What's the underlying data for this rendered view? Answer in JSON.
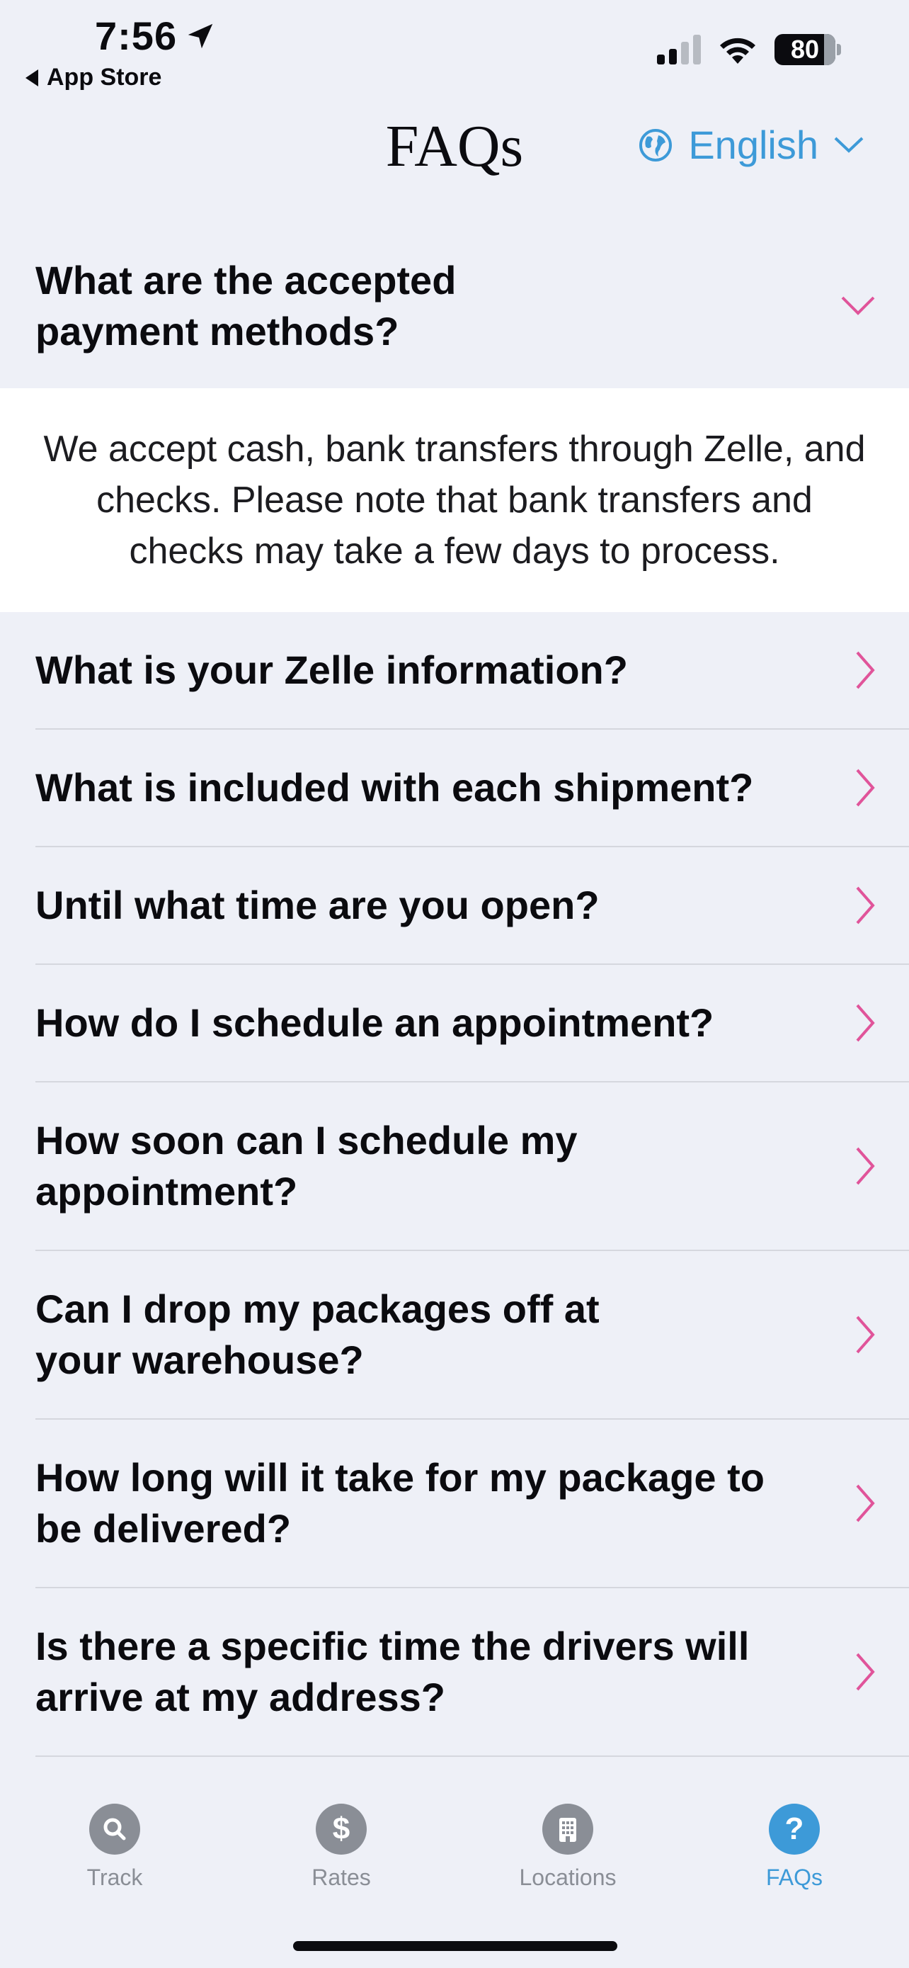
{
  "status_bar": {
    "time": "7:56",
    "back_label": "App Store",
    "battery": "80"
  },
  "header": {
    "title": "FAQs",
    "language": "English"
  },
  "faqs": [
    {
      "question": "What are the accepted payment methods?",
      "expanded": true,
      "answer": "We accept cash, bank transfers through Zelle, and checks. Please note that bank transfers and checks may take a few days to process."
    },
    {
      "question": "What is your Zelle information?",
      "expanded": false
    },
    {
      "question": "What is included with each shipment?",
      "expanded": false
    },
    {
      "question": "Until what time are you open?",
      "expanded": false
    },
    {
      "question": "How do I schedule an appointment?",
      "expanded": false
    },
    {
      "question": "How soon can I schedule my appointment?",
      "expanded": false
    },
    {
      "question": "Can I drop my packages off at your warehouse?",
      "expanded": false
    },
    {
      "question": "How long will it take for my package to be delivered?",
      "expanded": false
    },
    {
      "question": "Is there a specific time the drivers will arrive at my address?",
      "expanded": false
    }
  ],
  "tabs": [
    {
      "label": "Track",
      "icon": "search-icon",
      "active": false
    },
    {
      "label": "Rates",
      "icon": "dollar-icon",
      "active": false
    },
    {
      "label": "Locations",
      "icon": "building-icon",
      "active": false
    },
    {
      "label": "FAQs",
      "icon": "question-icon",
      "active": true
    }
  ],
  "colors": {
    "accent": "#3d9ad8",
    "chevron": "#e0549a",
    "background": "#eef0f7"
  }
}
